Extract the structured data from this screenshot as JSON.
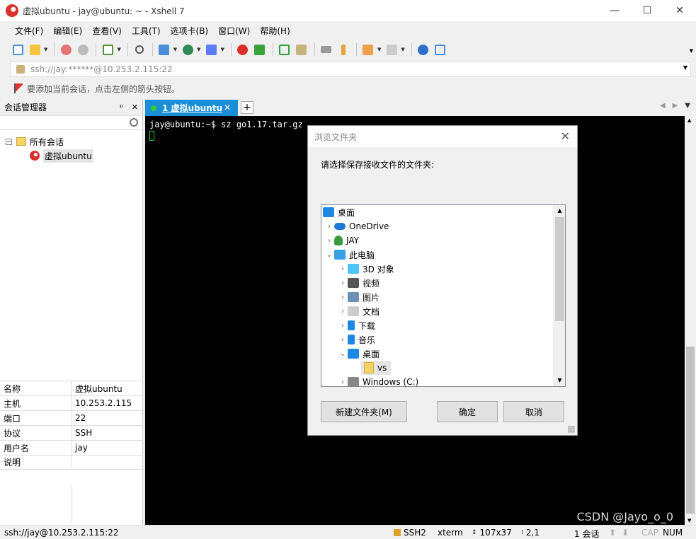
{
  "window": {
    "title": "虚拟ubuntu - jay@ubuntu: ~ - Xshell 7",
    "min": "—",
    "max": "☐",
    "close": "✕"
  },
  "menu": [
    "文件(F)",
    "编辑(E)",
    "查看(V)",
    "工具(T)",
    "选项卡(B)",
    "窗口(W)",
    "帮助(H)"
  ],
  "address": {
    "value": "ssh://jay:******@10.253.2.115:22",
    "lock_icon": "lock-icon"
  },
  "hint": "要添加当前会话，点击左侧的箭头按钮。",
  "session_manager": {
    "title": "会话管理器",
    "pin": "ᵖ",
    "close": "✕",
    "tree_root": "所有会话",
    "tree_session": "虚拟ubuntu",
    "properties": [
      {
        "key": "名称",
        "value": "虚拟ubuntu"
      },
      {
        "key": "主机",
        "value": "10.253.2.115"
      },
      {
        "key": "端口",
        "value": "22"
      },
      {
        "key": "协议",
        "value": "SSH"
      },
      {
        "key": "用户名",
        "value": "jay"
      },
      {
        "key": "说明",
        "value": ""
      }
    ]
  },
  "tab": {
    "label": "1 虚拟ubuntu",
    "close": "✕",
    "add": "+"
  },
  "terminal": {
    "line1": "jay@ubuntu:~$ sz go1.17.tar.gz"
  },
  "watermark": "CSDN @Jayo_o_0",
  "dialog": {
    "title": "浏览文件夹",
    "prompt": "请选择保存接收文件的文件夹:",
    "tree": [
      {
        "label": "桌面",
        "depth": 0,
        "arrow": "",
        "icon": "desktop-icon",
        "color": "#1e88e5"
      },
      {
        "label": "OneDrive",
        "depth": 1,
        "arrow": "›",
        "icon": "cloud-icon",
        "color": "#1e78d6"
      },
      {
        "label": "JAY",
        "depth": 1,
        "arrow": "›",
        "icon": "user-icon",
        "color": "#3a9a3a"
      },
      {
        "label": "此电脑",
        "depth": 1,
        "arrow": "⌄",
        "icon": "computer-icon",
        "color": "#3aa0e8"
      },
      {
        "label": "3D 对象",
        "depth": 2,
        "arrow": "›",
        "icon": "cube-icon",
        "color": "#4fc3f7"
      },
      {
        "label": "视频",
        "depth": 2,
        "arrow": "›",
        "icon": "video-icon",
        "color": "#555555"
      },
      {
        "label": "图片",
        "depth": 2,
        "arrow": "›",
        "icon": "picture-icon",
        "color": "#6b8fb5"
      },
      {
        "label": "文档",
        "depth": 2,
        "arrow": "›",
        "icon": "document-icon",
        "color": "#cccccc"
      },
      {
        "label": "下载",
        "depth": 2,
        "arrow": "›",
        "icon": "download-icon",
        "color": "#1e88e5"
      },
      {
        "label": "音乐",
        "depth": 2,
        "arrow": "›",
        "icon": "music-icon",
        "color": "#1e88e5"
      },
      {
        "label": "桌面",
        "depth": 2,
        "arrow": "⌄",
        "icon": "desktop-icon",
        "color": "#1e88e5"
      },
      {
        "label": "vs",
        "depth": 3,
        "arrow": "",
        "icon": "folder-icon",
        "color": "#f5d266",
        "selected": true
      },
      {
        "label": "Windows (C:)",
        "depth": 2,
        "arrow": "›",
        "icon": "drive-icon",
        "color": "#888888"
      }
    ],
    "buttons": {
      "new_folder": "新建文件夹(M)",
      "ok": "确定",
      "cancel": "取消"
    }
  },
  "status": {
    "connection": "ssh://jay@10.253.2.115:22",
    "protocol": "SSH2",
    "term": "xterm",
    "size": "107x37",
    "pos": "2,1",
    "sessions": "1 会话",
    "caps": "CAP",
    "num": "NUM"
  }
}
